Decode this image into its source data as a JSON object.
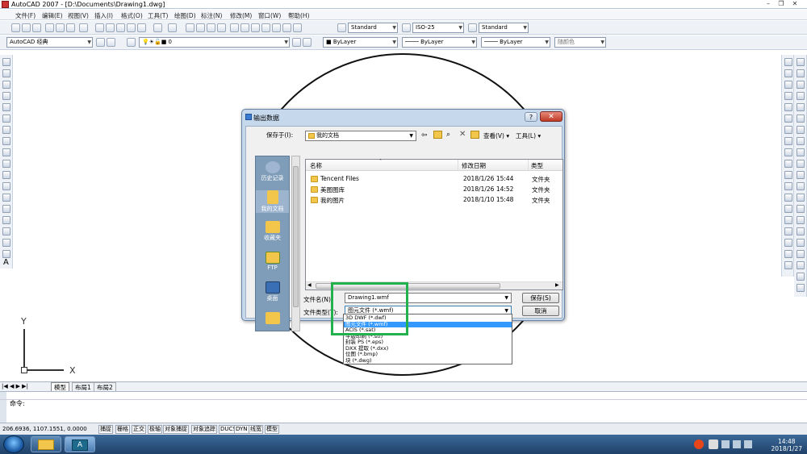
{
  "app": {
    "title": "AutoCAD 2007 - [D:\\Documents\\Drawing1.dwg]",
    "menu": [
      "文件(F)",
      "编辑(E)",
      "视图(V)",
      "插入(I)",
      "格式(O)",
      "工具(T)",
      "绘图(D)",
      "标注(N)",
      "修改(M)",
      "窗口(W)",
      "帮助(H)"
    ]
  },
  "toolbar": {
    "text_style": "Standard",
    "dim_style": "ISO-25",
    "table_style": "Standard",
    "workspace": "AutoCAD 经典",
    "layer": "0",
    "color": "ByLayer",
    "linetype": "ByLayer",
    "lineweight": "ByLayer",
    "plotstyle": "随颜色"
  },
  "tabs": [
    "模型",
    "布局1",
    "布局2"
  ],
  "command": {
    "prompt": "命令:"
  },
  "status": {
    "coords": "206.6936,  1107.1551, 0.0000",
    "toggles": [
      "捕捉",
      "栅格",
      "正交",
      "极轴",
      "对象捕捉",
      "对象追踪",
      "DUCS",
      "DYN",
      "线宽",
      "模型"
    ]
  },
  "ucs": {
    "y": "Y",
    "x": "X"
  },
  "dialog": {
    "title": "输出数据",
    "help": "?",
    "close": "✕",
    "save_in_label": "保存于(I):",
    "save_in_value": "我的文档",
    "views_label": "查看(V)",
    "tools_label": "工具(L)",
    "places": [
      "历史记录",
      "我的文档",
      "收藏夹",
      "FTP",
      "桌面"
    ],
    "columns": [
      "名称",
      "修改日期",
      "类型"
    ],
    "files": [
      {
        "name": "Tencent Files",
        "date": "2018/1/26 15:44",
        "type": "文件夹"
      },
      {
        "name": "美图图库",
        "date": "2018/1/26 14:52",
        "type": "文件夹"
      },
      {
        "name": "我的图片",
        "date": "2018/1/10 15:48",
        "type": "文件夹"
      }
    ],
    "filename_label": "文件名(N):",
    "filename_value": "Drawing1.wmf",
    "filetype_label": "文件类型(T):",
    "filetype_value": "图元文件 (*.wmf)",
    "save_btn": "保存(S)",
    "cancel_btn": "取消",
    "filetype_options": [
      "3D DWF (*.dwf)",
      "图元文件 (*.wmf)",
      "ACIS (*.sat)",
      "平版印刷 (*.stl)",
      "封装 PS (*.eps)",
      "DXX 提取 (*.dxx)",
      "位图 (*.bmp)",
      "块 (*.dwg)"
    ]
  },
  "taskbar": {
    "time": "14:48",
    "date": "2018/1/27"
  },
  "colors": {
    "highlight": "#22b14c",
    "selection": "#3399ff"
  }
}
